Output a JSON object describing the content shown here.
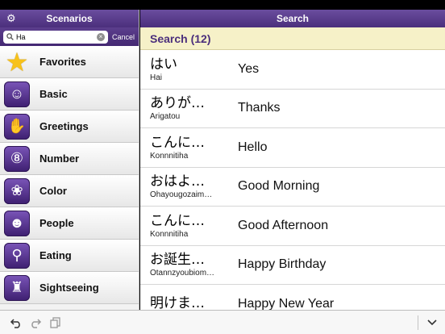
{
  "sidebar": {
    "title": "Scenarios",
    "settings_icon": "gear-icon",
    "search": {
      "value": "Ha",
      "placeholder": "",
      "cancel_label": "Cancel"
    },
    "items": [
      {
        "label": "Favorites",
        "icon": "star-icon"
      },
      {
        "label": "Basic",
        "icon": "smiley-icon"
      },
      {
        "label": "Greetings",
        "icon": "hand-icon"
      },
      {
        "label": "Number",
        "icon": "number-8-icon"
      },
      {
        "label": "Color",
        "icon": "palette-icon"
      },
      {
        "label": "People",
        "icon": "people-icon"
      },
      {
        "label": "Eating",
        "icon": "utensils-icon"
      },
      {
        "label": "Sightseeing",
        "icon": "landmark-icon"
      }
    ]
  },
  "main": {
    "title": "Search",
    "results_header": "Search (12)",
    "results": [
      {
        "jp": "はい",
        "romaji": "Hai",
        "en": "Yes"
      },
      {
        "jp": "ありが…",
        "romaji": "Arigatou",
        "en": "Thanks"
      },
      {
        "jp": "こんに…",
        "romaji": "Konnnitiha",
        "en": "Hello"
      },
      {
        "jp": "おはよ…",
        "romaji": "Ohayougozaim…",
        "en": "Good Morning"
      },
      {
        "jp": "こんに…",
        "romaji": "Konnnitiha",
        "en": "Good Afternoon"
      },
      {
        "jp": "お誕生…",
        "romaji": "Otannzyoubiom…",
        "en": "Happy Birthday"
      },
      {
        "jp": "明けま…",
        "romaji": "",
        "en": "Happy New Year"
      }
    ]
  },
  "toolbar": {
    "buttons": [
      "undo-icon",
      "redo-icon",
      "clipboard-icon",
      "chevron-down-icon"
    ]
  }
}
